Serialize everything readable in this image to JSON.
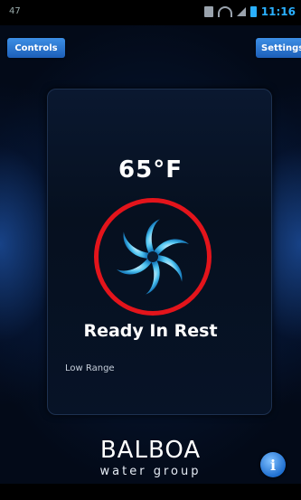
{
  "status_bar": {
    "left_indicator": "47",
    "time": "11:16"
  },
  "top": {
    "controls_label": "Controls",
    "settings_label": "Settings"
  },
  "main": {
    "temperature": "65°F",
    "status": "Ready In Rest",
    "range": "Low Range"
  },
  "brand": {
    "name": "BALBOA",
    "sub": "water group"
  },
  "colors": {
    "accent": "#2ab0ff",
    "button": "#2d7ad8",
    "highlight_ring": "#e3141b"
  },
  "icons": {
    "heater": "swirl-icon",
    "info": "info-icon"
  }
}
